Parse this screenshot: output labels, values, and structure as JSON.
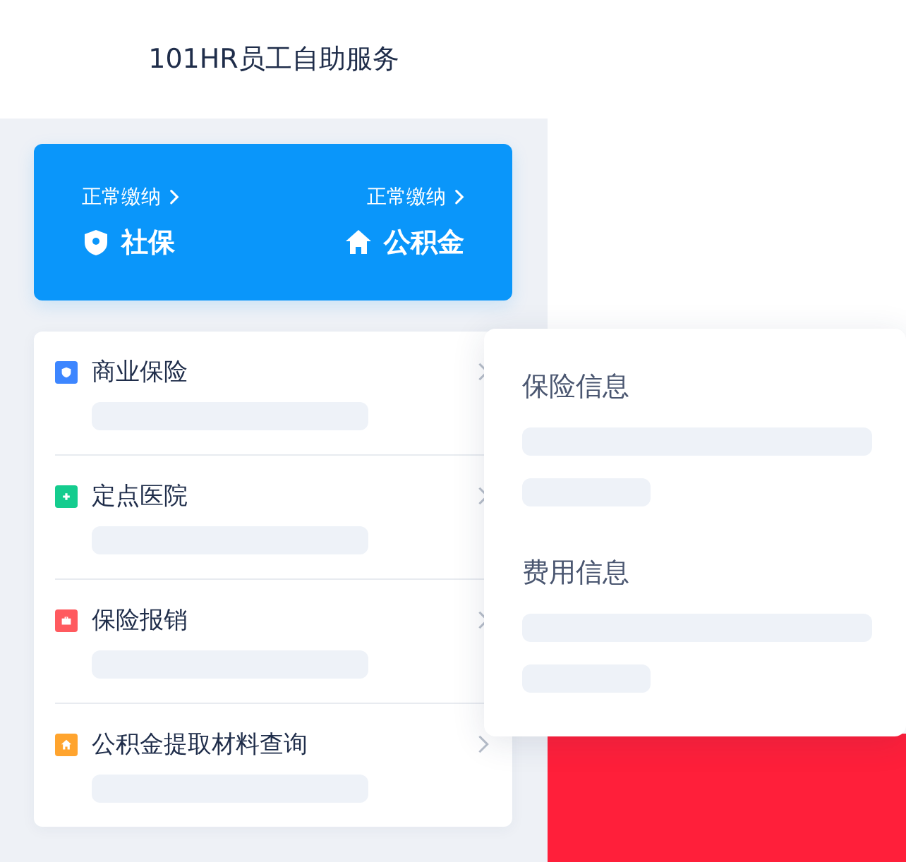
{
  "header": {
    "title": "101HR员工自助服务"
  },
  "benefits": [
    {
      "kind": "shield",
      "status": "正常缴纳",
      "label": "社保"
    },
    {
      "kind": "house",
      "status": "正常缴纳",
      "label": "公积金"
    }
  ],
  "services": [
    {
      "kind": "shield",
      "color": "#3d86ff",
      "title": "商业保险"
    },
    {
      "kind": "plus",
      "color": "#14cc8e",
      "title": "定点医院"
    },
    {
      "kind": "case",
      "color": "#ff5a5f",
      "title": "保险报销"
    },
    {
      "kind": "house",
      "color": "#ffa42e",
      "title": "公积金提取材料查询"
    }
  ],
  "detail_panel": {
    "sections": [
      {
        "heading": "保险信息"
      },
      {
        "heading": "费用信息"
      }
    ]
  }
}
